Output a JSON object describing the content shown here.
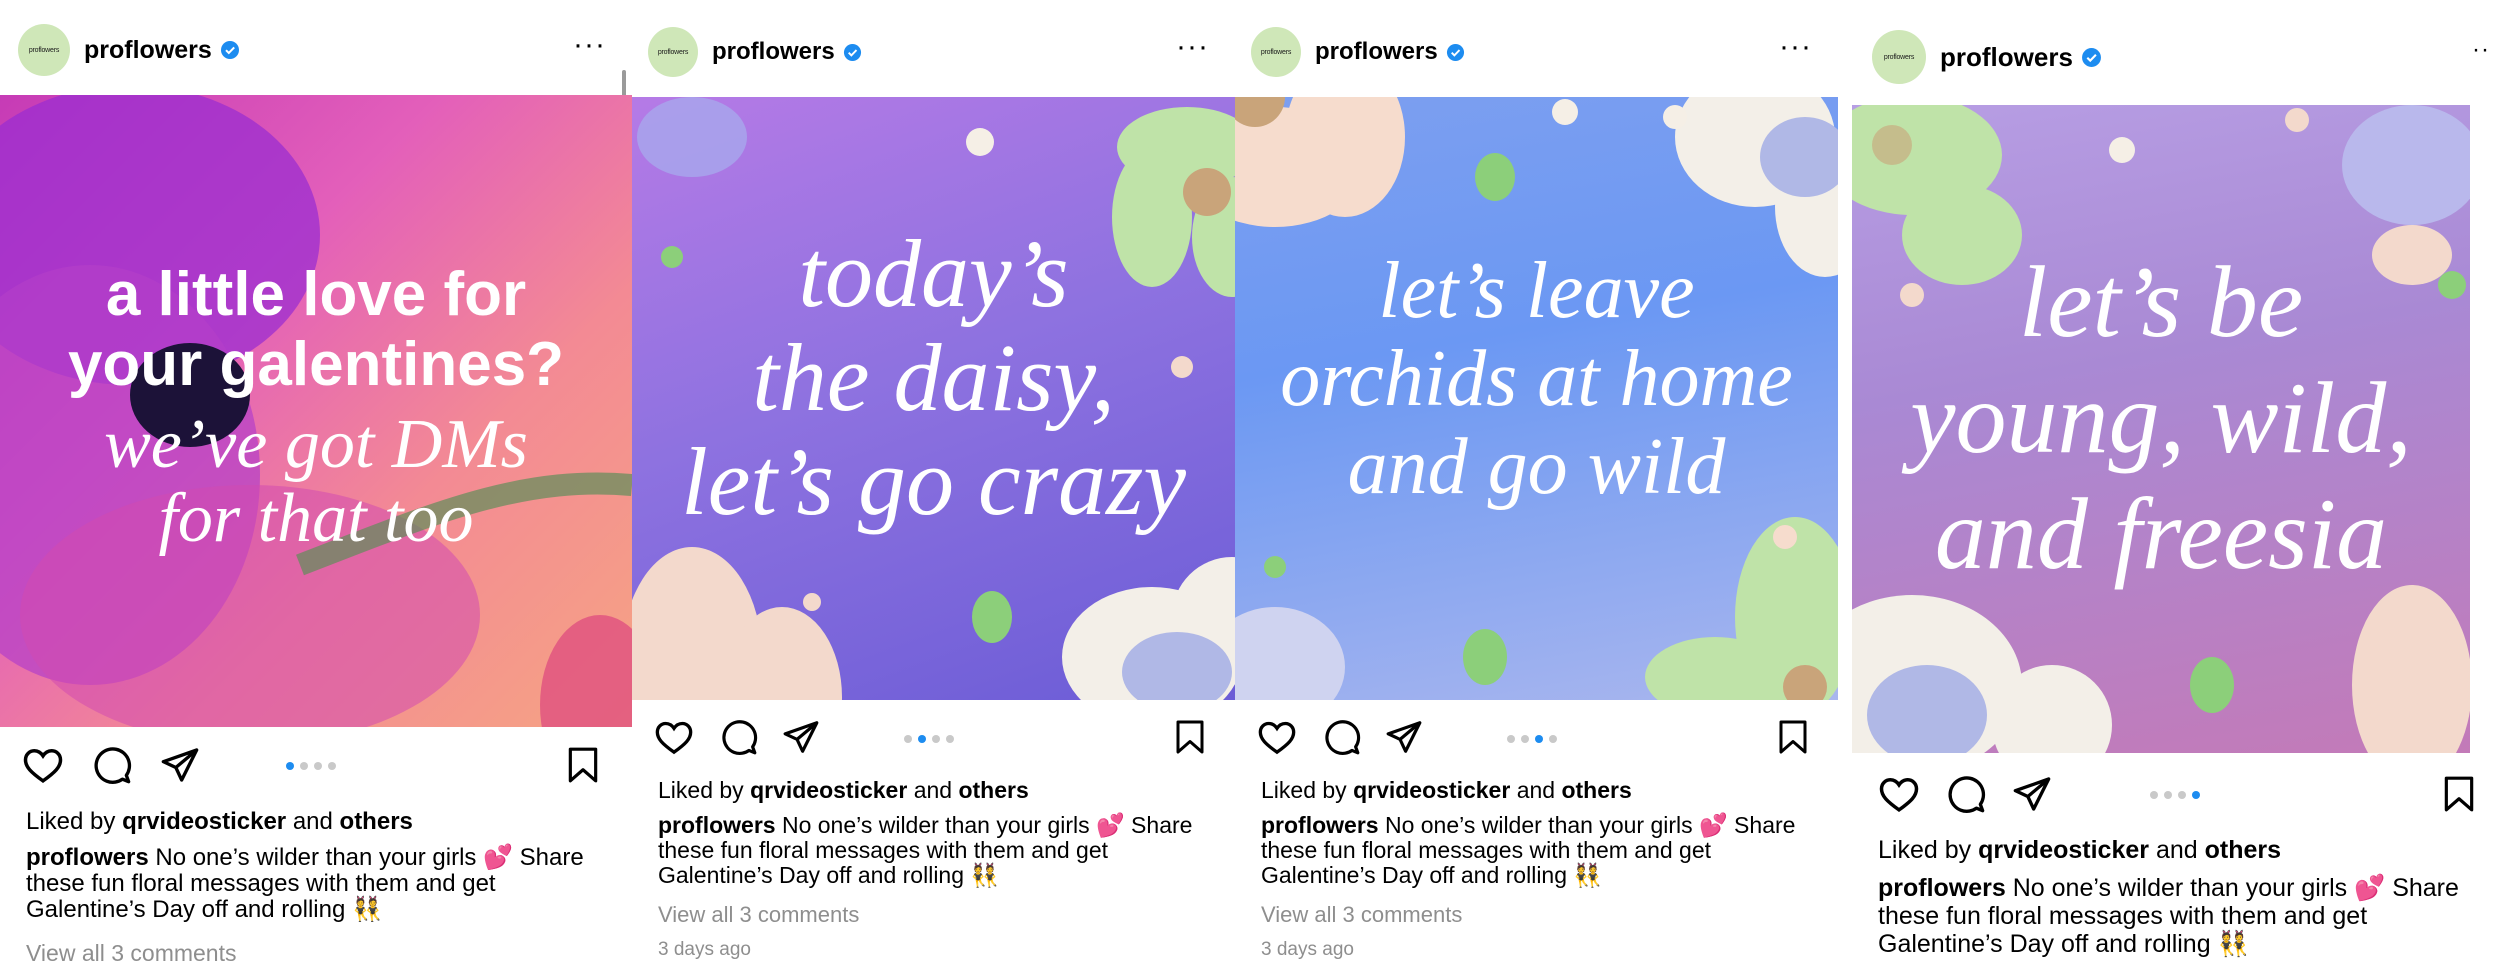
{
  "account": {
    "username": "proflowers",
    "avatar_text": "proflowers"
  },
  "liked_by": {
    "prefix": "Liked by",
    "user": "qrvideosticker",
    "and": "and",
    "others": "others"
  },
  "caption": {
    "user": "proflowers",
    "text": "No one’s wilder than your girls 💕 Share these fun floral messages with them and get Galentine’s Day off and rolling 👯"
  },
  "comments_link": "View all 3 comments",
  "time_ago": "3 days ago",
  "colors": {
    "verified": "#1d8cf0",
    "dot_active": "#1d8cf0",
    "dot_inactive": "#c9c9c9",
    "muted_text": "#8e8e8e"
  },
  "icons": [
    "verified-badge-icon",
    "more-options-icon",
    "heart-icon",
    "comment-icon",
    "share-icon",
    "bookmark-icon"
  ],
  "posts": [
    {
      "lines": [
        "a little love for",
        "your galentines?",
        "we’ve got DMs",
        "for that too"
      ],
      "carousel": {
        "count": 4,
        "active": 1
      }
    },
    {
      "lines": [
        "today’s",
        "the daisy,",
        "let’s go crazy"
      ],
      "carousel": {
        "count": 4,
        "active": 2
      }
    },
    {
      "lines": [
        "let’s leave",
        "orchids at home",
        "and go wild"
      ],
      "carousel": {
        "count": 4,
        "active": 3
      }
    },
    {
      "lines": [
        "let’s be",
        "young, wild,",
        "and freesia"
      ],
      "carousel": {
        "count": 4,
        "active": 4
      }
    }
  ]
}
